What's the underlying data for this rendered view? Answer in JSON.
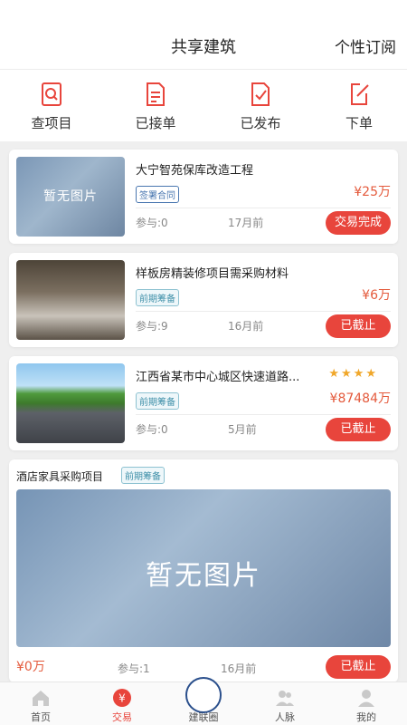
{
  "header": {
    "title": "共享建筑",
    "subscribe": "个性订阅"
  },
  "quick_actions": [
    {
      "label": "查项目",
      "icon": "search-doc-icon"
    },
    {
      "label": "已接单",
      "icon": "list-doc-icon"
    },
    {
      "label": "已发布",
      "icon": "check-doc-icon"
    },
    {
      "label": "下单",
      "icon": "edit-icon"
    }
  ],
  "colors": {
    "accent": "#e8453c",
    "price": "#e45a3c",
    "tag_blue": "#4a77b0"
  },
  "projects": [
    {
      "title": "大宁智苑保库改造工程",
      "thumb_text": "暂无图片",
      "tag": "签署合同",
      "price": "¥25万",
      "participants": "参与:0",
      "time": "17月前",
      "status": "交易完成"
    },
    {
      "title": "样板房精装修项目需采购材料",
      "tag": "前期筹备",
      "price": "¥6万",
      "participants": "参与:9",
      "time": "16月前",
      "status": "已截止"
    },
    {
      "title": "江西省某市中心城区快速道路...",
      "stars": "★★★★",
      "tag": "前期筹备",
      "price": "¥87484万",
      "participants": "参与:0",
      "time": "5月前",
      "status": "已截止"
    }
  ],
  "featured": {
    "title": "酒店家具采购项目",
    "tag": "前期筹备",
    "image_text": "暂无图片",
    "price": "¥0万",
    "participants": "参与:1",
    "time": "16月前",
    "status": "已截止"
  },
  "tabs": [
    {
      "label": "首页",
      "icon": "home-icon"
    },
    {
      "label": "交易",
      "icon": "yuan-icon"
    },
    {
      "label": "建联圈",
      "icon": "globe-logo-icon"
    },
    {
      "label": "人脉",
      "icon": "people-icon"
    },
    {
      "label": "我的",
      "icon": "user-icon"
    }
  ]
}
